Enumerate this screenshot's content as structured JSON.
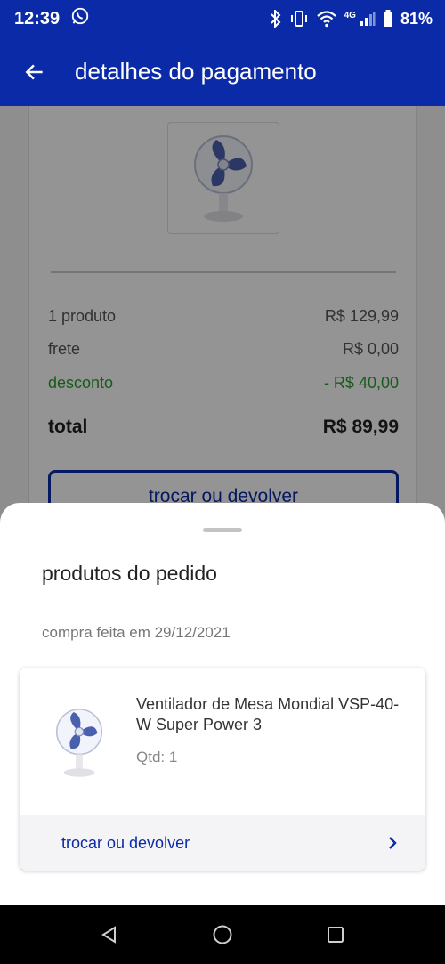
{
  "status_bar": {
    "time": "12:39",
    "network": "4G",
    "battery": "81%",
    "icons": [
      "whatsapp-icon",
      "bluetooth-icon",
      "vibrate-icon",
      "wifi-icon",
      "signal-icon",
      "battery-icon"
    ]
  },
  "app_bar": {
    "title": "detalhes do pagamento",
    "back_icon": "arrow-left-icon"
  },
  "summary": {
    "product_row": {
      "label": "1 produto",
      "value": "R$ 129,99"
    },
    "shipping_row": {
      "label": "frete",
      "value": "R$ 0,00"
    },
    "discount_row": {
      "label": "desconto",
      "value": "- R$ 40,00"
    },
    "total_row": {
      "label": "total",
      "value": "R$ 89,99"
    },
    "exchange_button": "trocar ou devolver"
  },
  "sheet": {
    "title": "produtos do pedido",
    "purchase_date": "compra feita em 29/12/2021",
    "item": {
      "name": "Ventilador de Mesa Mondial VSP-40-W Super Power 3",
      "qty": "Qtd: 1",
      "action": "trocar ou devolver"
    }
  },
  "colors": {
    "primary": "#0a2aa8",
    "discount": "#2a9d2a",
    "scrim": "rgba(0,0,0,0.42)"
  },
  "nav_bar": {
    "icons": [
      "back-triangle-icon",
      "home-circle-icon",
      "recents-square-icon"
    ]
  }
}
